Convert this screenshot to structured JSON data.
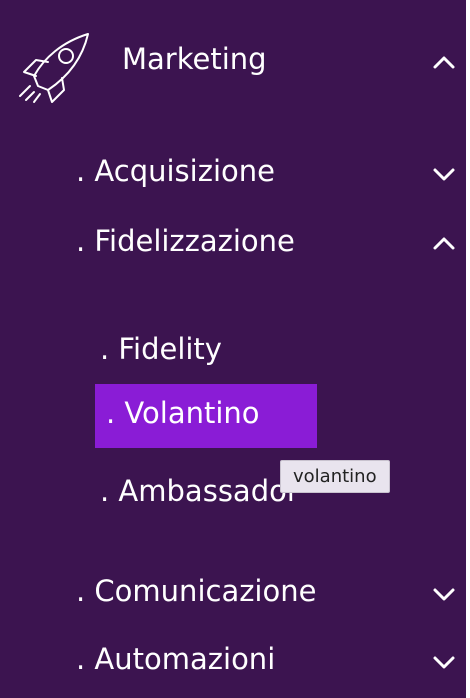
{
  "colors": {
    "sidebar_bg": "#3c1450",
    "active_bg": "#8a1cd6",
    "text": "#ffffff",
    "tooltip_bg": "#e9e4ee",
    "tooltip_text": "#222222"
  },
  "menu": {
    "title": "Marketing",
    "title_icon": "rocket-icon",
    "title_state": "expanded",
    "sections": [
      {
        "label": ". Acquisizione",
        "state": "collapsed"
      },
      {
        "label": ". Fidelizzazione",
        "state": "expanded",
        "items": [
          {
            "label": ". Fidelity"
          },
          {
            "label": ". Volantino",
            "active": true
          },
          {
            "label": ". Ambassador"
          }
        ]
      },
      {
        "label": ". Comunicazione",
        "state": "collapsed"
      },
      {
        "label": ". Automazioni",
        "state": "collapsed"
      }
    ]
  },
  "tooltip": {
    "text": "volantino"
  }
}
